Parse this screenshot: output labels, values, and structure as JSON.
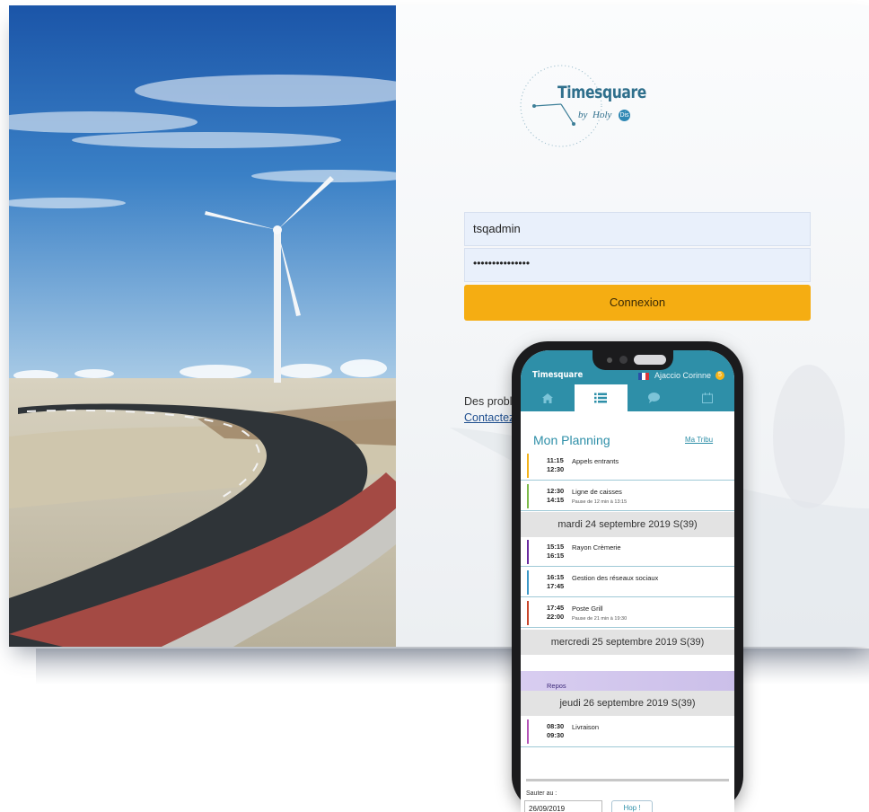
{
  "login": {
    "logo_word": "Timesquare",
    "logo_by": "by",
    "logo_holy": "Holy",
    "logo_badge": "Dis",
    "username_value": "tsqadmin",
    "password_masked": "•••••••••••••••",
    "connect_label": "Connexion",
    "help_text": "Des problè",
    "help_link": "Contactez-"
  },
  "phone": {
    "app_title": "Timesquare",
    "user_name": "Ajaccio Corinne",
    "user_badge": "5",
    "tabs": [
      {
        "icon": "home-icon",
        "active": false
      },
      {
        "icon": "list-icon",
        "active": true
      },
      {
        "icon": "chat-icon",
        "active": false
      },
      {
        "icon": "calendar-icon",
        "active": false
      }
    ],
    "planning_title": "Mon Planning",
    "tribu_link": "Ma Tribu",
    "events": [
      {
        "start": "11:15",
        "end": "12:30",
        "label": "Appels entrants",
        "sub": "",
        "color": "#f2b31c"
      },
      {
        "start": "12:30",
        "end": "14:15",
        "label": "Ligne de caisses",
        "sub": "Pause de 12 min à 13:15",
        "color": "#7dbb4a"
      },
      {
        "start": "15:15",
        "end": "16:15",
        "label": "Rayon Crèmerie",
        "sub": "",
        "color": "#6a2ca0"
      },
      {
        "start": "16:15",
        "end": "17:45",
        "label": "Gestion des réseaux sociaux",
        "sub": "",
        "color": "#3d98c8"
      },
      {
        "start": "17:45",
        "end": "22:00",
        "label": "Poste Grill",
        "sub": "Pause de 21 min à 19:30",
        "color": "#c9472c"
      },
      {
        "start": "08:30",
        "end": "09:30",
        "label": "Livraison",
        "sub": "",
        "color": "#b455b8"
      }
    ],
    "days": [
      "mardi 24 septembre 2019 S(39)",
      "mercredi 25 septembre 2019 S(39)",
      "jeudi 26 septembre 2019 S(39)"
    ],
    "repos_label": "Repos",
    "jump_label": "Sauter au :",
    "jump_value": "26/09/2019",
    "hop_label": "Hop !"
  },
  "colors": {
    "brand_teal": "#2e8fa8",
    "connect_orange": "#f5ad12",
    "repos_purple": "#d8cdf0"
  }
}
